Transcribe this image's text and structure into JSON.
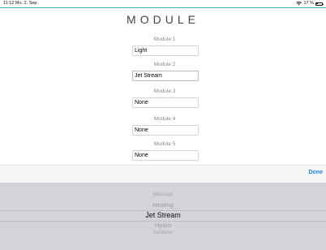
{
  "status": {
    "time_date": "11:12  Mo. 2. Sep.",
    "battery": "17 %",
    "battery_level": 0.17
  },
  "page": {
    "title": "MODULE"
  },
  "modules": [
    {
      "label": "Module 1",
      "value": "Light"
    },
    {
      "label": "Module 2",
      "value": "Jet Stream"
    },
    {
      "label": "Module 3",
      "value": "None"
    },
    {
      "label": "Module 4",
      "value": "None"
    },
    {
      "label": "Module 5",
      "value": "None"
    }
  ],
  "toolbar": {
    "done_label": "Done"
  },
  "picker": {
    "options": [
      "Massage",
      "Heating",
      "Jet Stream",
      "Hydro",
      "Soutterer"
    ],
    "selected": "Jet Stream"
  },
  "colors": {
    "accent": "#1a84e0",
    "top_line": "#3fa8c8",
    "picker_bg": "#d3d4d8"
  }
}
